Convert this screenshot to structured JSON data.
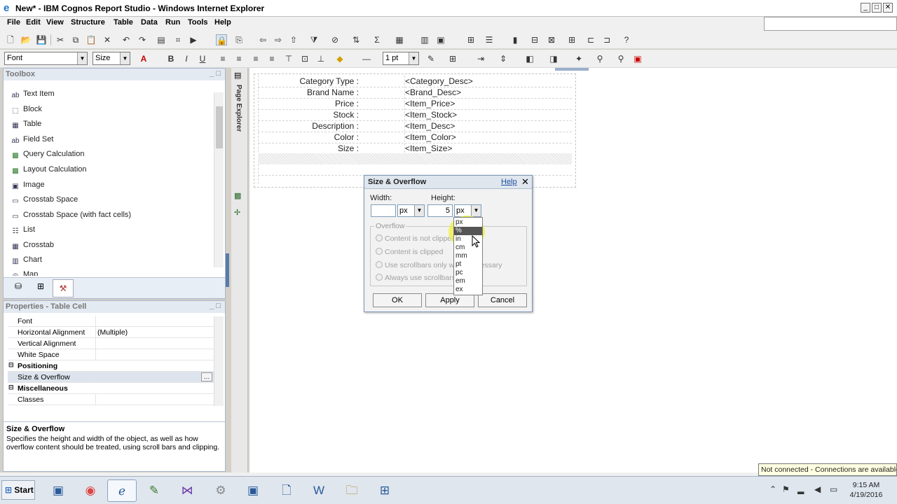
{
  "window": {
    "title": "New* - IBM Cognos Report Studio - Windows Internet Explorer"
  },
  "menu": [
    "File",
    "Edit",
    "View",
    "Structure",
    "Table",
    "Data",
    "Run",
    "Tools",
    "Help"
  ],
  "format_toolbar": {
    "font_value": "Font",
    "size_value": "Size",
    "line_value": "1 pt"
  },
  "toolbox": {
    "title": "Toolbox",
    "items": [
      {
        "label": "Text Item",
        "icon": "text-item-icon"
      },
      {
        "label": "Block",
        "icon": "block-icon"
      },
      {
        "label": "Table",
        "icon": "table-icon"
      },
      {
        "label": "Field Set",
        "icon": "field-set-icon"
      },
      {
        "label": "Query Calculation",
        "icon": "query-calculation-icon"
      },
      {
        "label": "Layout Calculation",
        "icon": "layout-calculation-icon"
      },
      {
        "label": "Image",
        "icon": "image-icon"
      },
      {
        "label": "Crosstab Space",
        "icon": "crosstab-space-icon"
      },
      {
        "label": "Crosstab Space (with fact cells)",
        "icon": "crosstab-space-fact-icon"
      },
      {
        "label": "List",
        "icon": "list-icon"
      },
      {
        "label": "Crosstab",
        "icon": "crosstab-icon"
      },
      {
        "label": "Chart",
        "icon": "chart-icon"
      },
      {
        "label": "Map",
        "icon": "map-icon"
      }
    ]
  },
  "properties": {
    "title": "Properties - Table Cell",
    "rows": [
      {
        "key": "Font",
        "value": ""
      },
      {
        "key": "Horizontal Alignment",
        "value": "(Multiple)"
      },
      {
        "key": "Vertical Alignment",
        "value": ""
      },
      {
        "key": "White Space",
        "value": ""
      },
      {
        "key": "Positioning",
        "value": "",
        "group": true
      },
      {
        "key": "Size & Overflow",
        "value": "",
        "selected": true
      },
      {
        "key": "Miscellaneous",
        "value": "",
        "group": true
      },
      {
        "key": "Classes",
        "value": ""
      }
    ],
    "description_title": "Size & Overflow",
    "description_text": "Specifies the height and width of the object, as well as how overflow content should be treated, using scroll bars and clipping."
  },
  "page_explorer_label": "Page Explorer",
  "report": {
    "rows": [
      {
        "label": "Category Type :",
        "value": "<Category_Desc>"
      },
      {
        "label": "Brand Name :",
        "value": "<Brand_Desc>"
      },
      {
        "label": "Price :",
        "value": "<Item_Price>"
      },
      {
        "label": "Stock :",
        "value": "<Item_Stock>"
      },
      {
        "label": "Description :",
        "value": "<Item_Desc>"
      },
      {
        "label": "Color :",
        "value": "<Item_Color>"
      },
      {
        "label": "Size :",
        "value": "<Item_Size>"
      }
    ]
  },
  "dialog": {
    "title": "Size & Overflow",
    "help": "Help",
    "width_label": "Width:",
    "height_label": "Height:",
    "width_value": "",
    "width_unit": "px",
    "height_value": "5",
    "height_unit": "px",
    "overflow_legend": "Overflow",
    "options": [
      "Content is not clipped",
      "Content is clipped",
      "Use scrollbars only when necessary",
      "Always use scrollbars"
    ],
    "ok": "OK",
    "apply": "Apply",
    "cancel": "Cancel",
    "unit_options": [
      "px",
      "%",
      "in",
      "cm",
      "mm",
      "pt",
      "pc",
      "em",
      "ex"
    ],
    "unit_hovered": "%"
  },
  "status": {
    "connection": "Not connected - Connections are available"
  },
  "taskbar": {
    "start": "Start",
    "time": "9:15 AM",
    "date": "4/19/2016"
  }
}
